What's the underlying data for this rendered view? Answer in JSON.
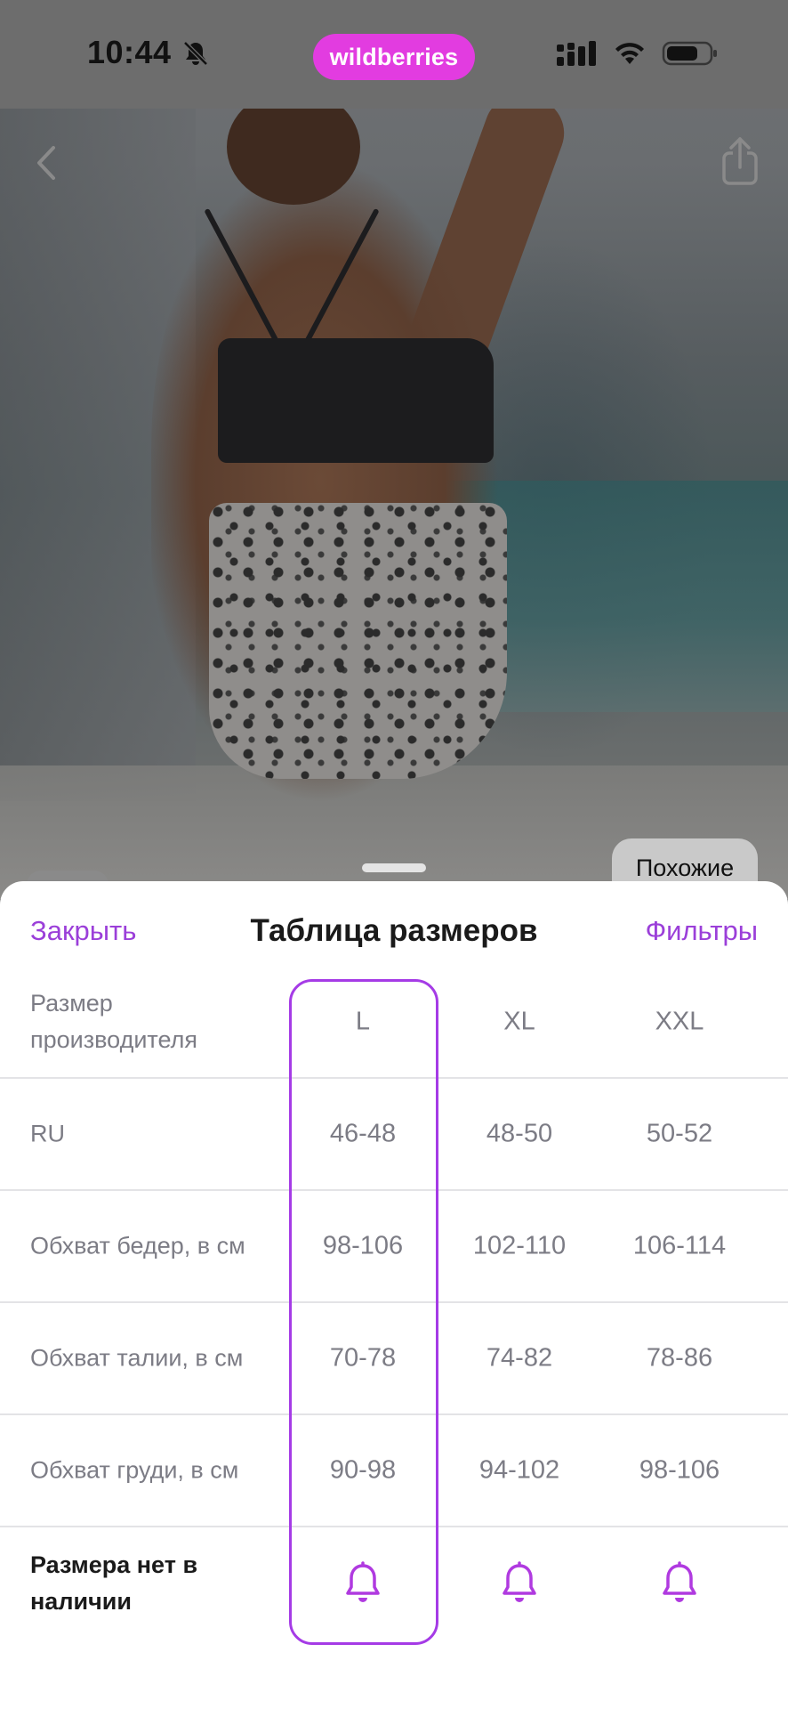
{
  "status_bar": {
    "time": "10:44",
    "brand": "wildberries",
    "icons": [
      "bell-off-icon",
      "signal-icon",
      "wifi-icon",
      "battery-icon"
    ]
  },
  "photo_controls": {
    "back_icon": "chevron-left-icon",
    "share_icon": "share-icon",
    "similar_label": "Похожие"
  },
  "sheet": {
    "close_label": "Закрыть",
    "title": "Таблица размеров",
    "filters_label": "Фильтры"
  },
  "table": {
    "header": {
      "label": "Размер производителя",
      "sizes": [
        "L",
        "XL",
        "XXL"
      ]
    },
    "rows": [
      {
        "label": "RU",
        "values": [
          "46-48",
          "48-50",
          "50-52"
        ]
      },
      {
        "label": "Обхват бедер, в см",
        "values": [
          "98-106",
          "102-110",
          "106-114"
        ]
      },
      {
        "label": "Обхват талии, в см",
        "values": [
          "70-78",
          "74-82",
          "78-86"
        ]
      },
      {
        "label": "Обхват груди, в см",
        "values": [
          "90-98",
          "94-102",
          "98-106"
        ]
      }
    ],
    "out_of_stock": {
      "label": "Размера нет в наличии",
      "action_icon": "bell-icon"
    },
    "selected_size": "L"
  },
  "colors": {
    "brand_pill": "#e23ce0",
    "accent": "#9b3fd9",
    "selection_border": "#a53be6",
    "muted_text": "#7c7c85"
  }
}
